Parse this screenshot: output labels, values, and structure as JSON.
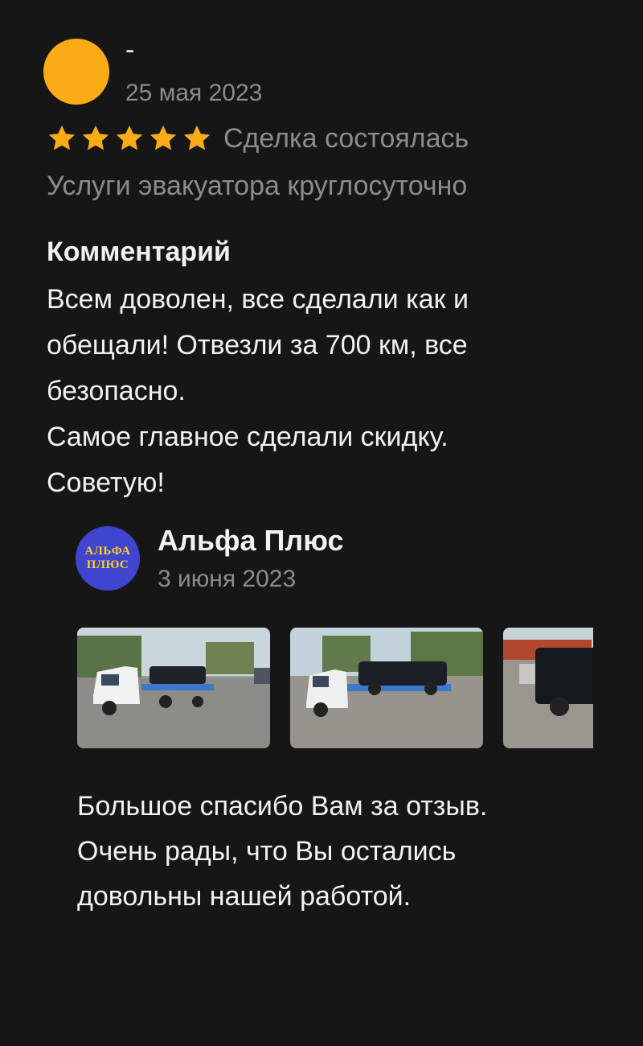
{
  "review": {
    "author_name": "-",
    "date": "25 мая 2023",
    "rating": 5,
    "rating_max": 5,
    "star_color": "#fbab15",
    "avatar_color": "#fbab15",
    "deal_status": "Сделка состоялась",
    "service_name": "Услуги эвакуатора круглосуточно",
    "comment_heading": "Комментарий",
    "comment_lines": [
      "Всем доволен, все сделали как и",
      "обещали! Отвезли за 700 км, все",
      "безопасно.",
      "Самое главное сделали скидку.",
      "Советую!"
    ]
  },
  "reply": {
    "avatar_text_line1": "АЛЬФА",
    "avatar_text_line2": "ПЛЮС",
    "avatar_bg": "#3f45cf",
    "avatar_text_color": "#ffd21c",
    "author_name": "Альфа Плюс",
    "date": "3 июня 2023",
    "photos": [
      {
        "icon": "tow-truck-photo"
      },
      {
        "icon": "tow-truck-photo"
      },
      {
        "icon": "parked-suv-photo"
      }
    ],
    "text_lines": [
      "Большое спасибо Вам за отзыв.",
      "Очень рады, что Вы остались",
      "довольны нашей работой."
    ]
  }
}
